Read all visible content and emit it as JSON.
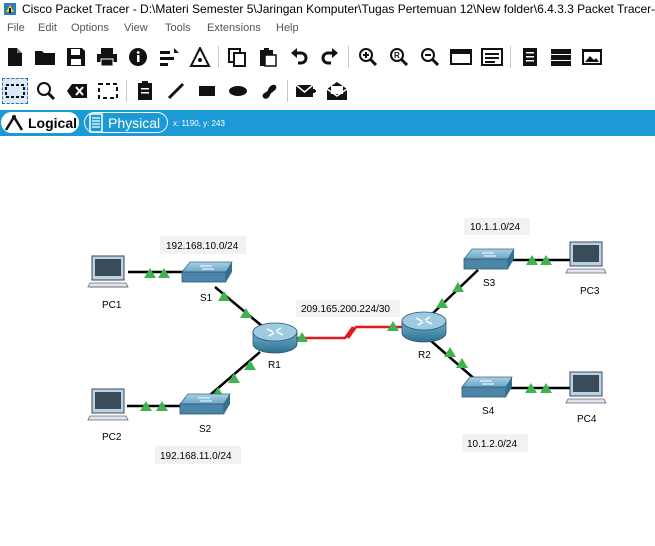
{
  "window": {
    "title": "Cisco Packet Tracer - D:\\Materi Semester 5\\Jaringan Komputer\\Tugas Pertemuan 12\\New folder\\6.4.3.3 Packet Tracer-Co"
  },
  "menu": [
    "File",
    "Edit",
    "Options",
    "View",
    "Tools",
    "Extensions",
    "Help"
  ],
  "toolbar_main": [
    "new-file-icon",
    "open-folder-icon",
    "save-icon",
    "print-icon",
    "info-icon",
    "activity-wizard-icon",
    "network-info-icon",
    "copy-icon",
    "paste-icon",
    "undo-icon",
    "redo-icon",
    "zoom-in-icon",
    "zoom-reset-icon",
    "zoom-out-icon",
    "palette-icon",
    "custom-device-icon",
    "text-file-icon",
    "server-icon",
    "screenshot-icon"
  ],
  "toolbar_tools": [
    "select-icon",
    "inspect-icon",
    "delete-icon",
    "resize-icon",
    "note-icon",
    "line-icon",
    "rectangle-icon",
    "ellipse-icon",
    "freeform-icon",
    "simple-pdu-icon",
    "complex-pdu-icon"
  ],
  "modes": {
    "logical": "Logical",
    "physical": "Physical",
    "coords": "x: 1190, y: 243"
  },
  "topology": {
    "devices": {
      "pc1": "PC1",
      "pc2": "PC2",
      "pc3": "PC3",
      "pc4": "PC4",
      "s1": "S1",
      "s2": "S2",
      "s3": "S3",
      "s4": "S4",
      "r1": "R1",
      "r2": "R2"
    },
    "networks": {
      "lan1": "192.168.10.0/24",
      "lan2": "192.168.11.0/24",
      "wan": "209.165.200.224/30",
      "lan3": "10.1.1.0/24",
      "lan4": "10.1.2.0/24"
    }
  },
  "colors": {
    "mode_bar": "#1b9ad6",
    "link": "#000000",
    "serial_link": "#e0191e",
    "link_up": "#3fb34f"
  }
}
